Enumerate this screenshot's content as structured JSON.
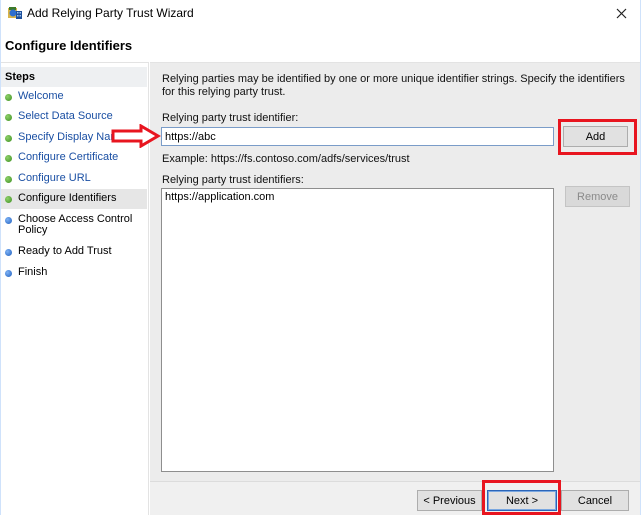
{
  "window": {
    "title": "Add Relying Party Trust Wizard",
    "close_icon": "close-icon",
    "app_icon": "adfs-wizard-icon"
  },
  "header": {
    "title": "Configure Identifiers"
  },
  "sidebar": {
    "heading": "Steps",
    "steps": [
      {
        "label": "Welcome",
        "state": "done",
        "link": true
      },
      {
        "label": "Select Data Source",
        "state": "done",
        "link": true
      },
      {
        "label": "Specify Display Name",
        "state": "done",
        "link": true
      },
      {
        "label": "Configure Certificate",
        "state": "done",
        "link": true
      },
      {
        "label": "Configure URL",
        "state": "done",
        "link": true
      },
      {
        "label": "Configure Identifiers",
        "state": "current",
        "link": false
      },
      {
        "label": "Choose Access Control Policy",
        "state": "todo",
        "link": false
      },
      {
        "label": "Ready to Add Trust",
        "state": "todo",
        "link": false
      },
      {
        "label": "Finish",
        "state": "todo",
        "link": false
      }
    ]
  },
  "main": {
    "description": "Relying parties may be identified by one or more unique identifier strings. Specify the identifiers for this relying party trust.",
    "identifier_label": "Relying party trust identifier:",
    "identifier_value": "https://abc",
    "add_label": "Add",
    "example": "Example: https://fs.contoso.com/adfs/services/trust",
    "identifiers_label": "Relying party trust identifiers:",
    "identifiers": [
      "https://application.com"
    ],
    "remove_label": "Remove"
  },
  "footer": {
    "previous_label": "< Previous",
    "next_label": "Next >",
    "cancel_label": "Cancel"
  },
  "annotations": {
    "highlight_color": "#e8151f",
    "arrow_color": "#e8151f"
  }
}
